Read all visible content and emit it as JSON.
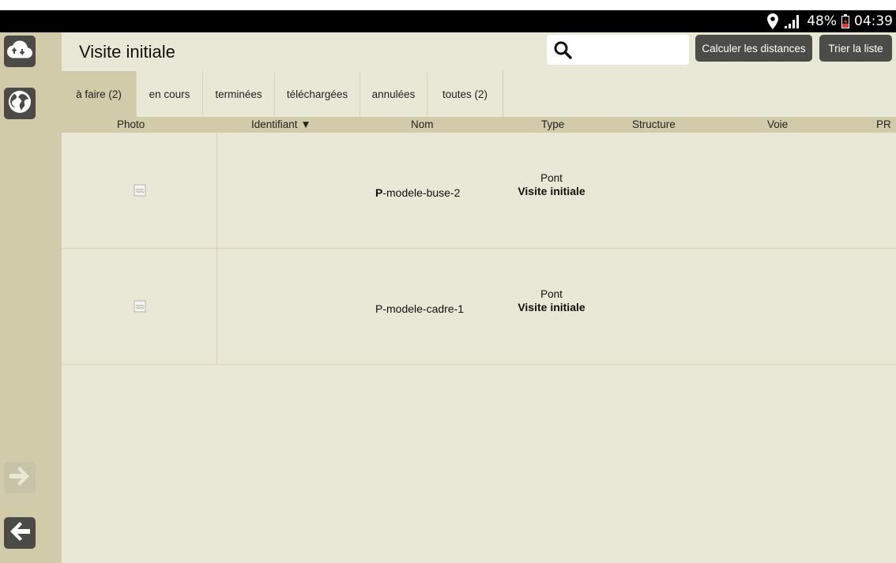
{
  "status": {
    "battery": "48%",
    "time": "04:39"
  },
  "header": {
    "title": "Visite initiale",
    "search_placeholder": "",
    "calc_button": "Calculer les distances",
    "sort_button": "Trier la liste"
  },
  "tabs": [
    {
      "label": "à faire (2)",
      "active": true
    },
    {
      "label": "en cours"
    },
    {
      "label": "terminées"
    },
    {
      "label": "téléchargées"
    },
    {
      "label": "annulées"
    },
    {
      "label": "toutes (2)"
    }
  ],
  "columns": {
    "photo": "Photo",
    "identifiant": "Identifiant",
    "nom": "Nom",
    "type": "Type",
    "structure": "Structure",
    "voie": "Voie",
    "pr": "PR"
  },
  "rows": [
    {
      "nom_prefix": "P",
      "nom_rest": "-modele-buse-2",
      "type": "Pont",
      "visite": "Visite initiale"
    },
    {
      "nom_prefix": "",
      "nom_rest": "P-modele-cadre-1",
      "type": "Pont",
      "visite": "Visite initiale"
    }
  ],
  "colors": {
    "sidebar": "#d1cba9",
    "background": "#e9e7d5",
    "button_dark": "#4b4b48"
  },
  "icons": [
    "cloud-sync-icon",
    "globe-icon",
    "arrow-right-icon",
    "arrow-left-icon",
    "search-icon",
    "location-icon",
    "signal-icon",
    "battery-icon",
    "sort-down-icon",
    "image-placeholder-icon"
  ]
}
